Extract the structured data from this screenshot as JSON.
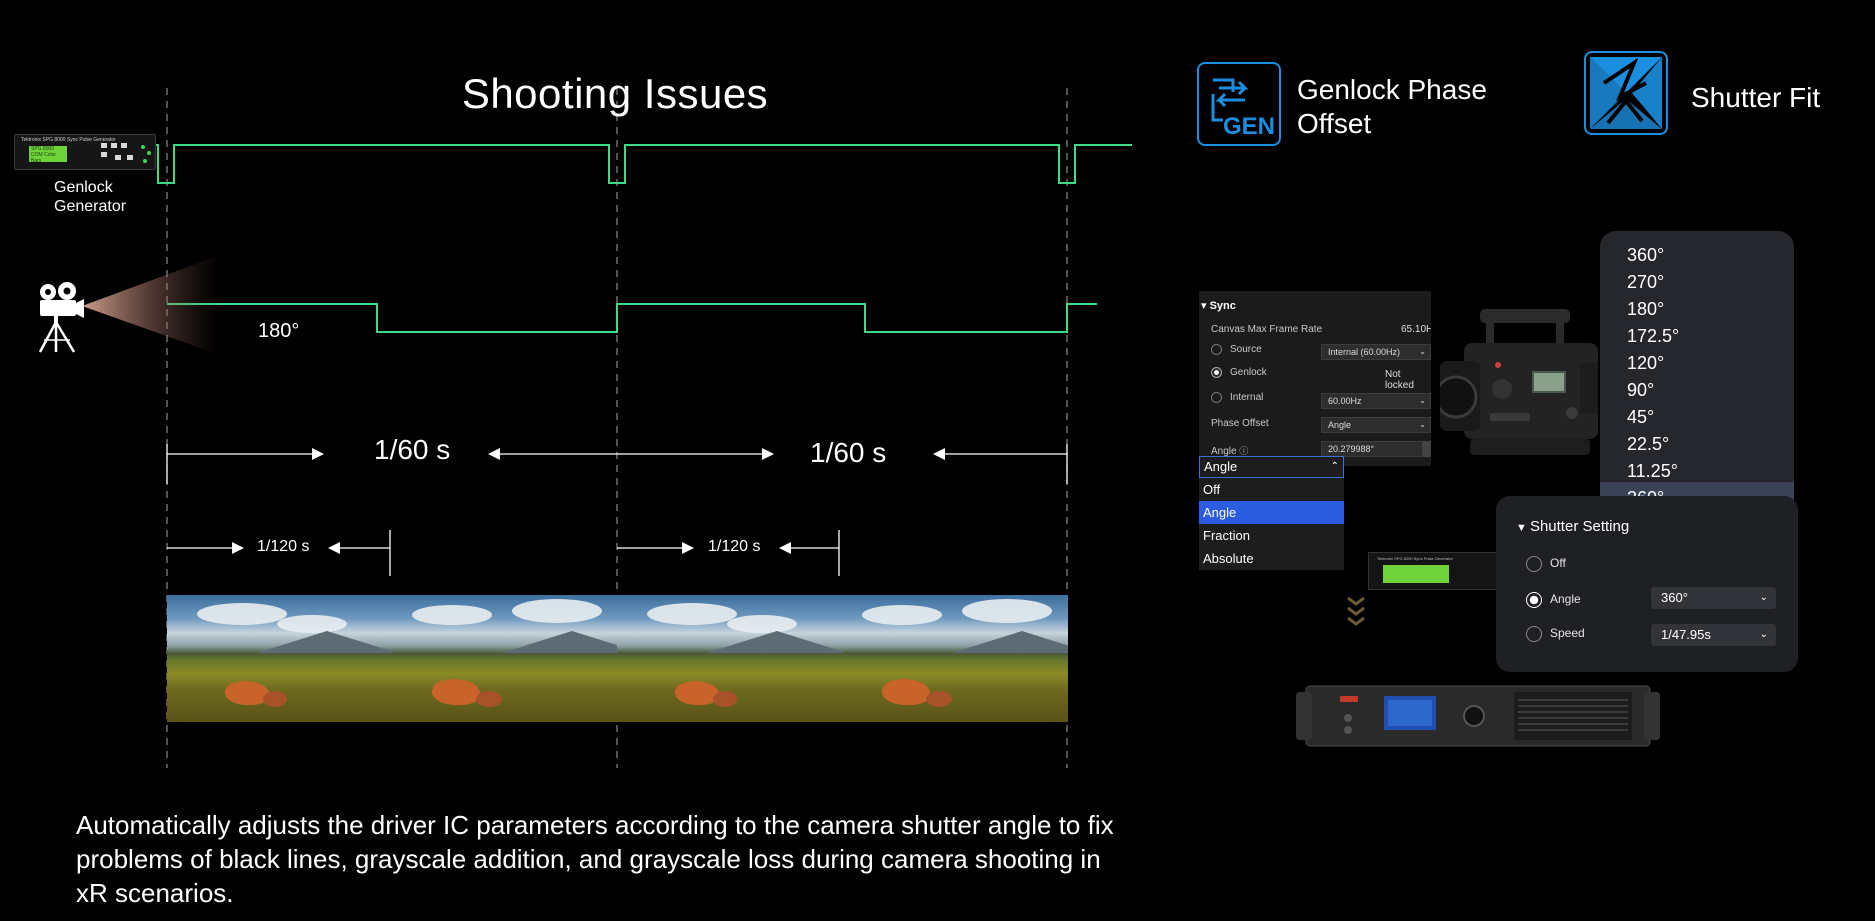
{
  "diagram": {
    "title": "Shooting Issues",
    "genlock_label": "Genlock\nGenerator",
    "shutter_angle": "180°",
    "period_left": "1/60 s",
    "period_right": "1/60 s",
    "half_left": "1/120 s",
    "half_right": "1/120 s",
    "device_brand": "Tektronix   SPG 8000 Sync Pulse Generator",
    "device_screen": [
      "SPG 8000",
      "COM Color Bars"
    ]
  },
  "description": "Automatically adjusts the driver IC parameters according to the camera shutter angle to fix problems of black lines, grayscale addition, and grayscale loss during camera shooting in xR scenarios.",
  "features": {
    "genlock": {
      "icon": "genlock-gen-icon",
      "icon_text": "GEN",
      "label": "Genlock Phase\nOffset"
    },
    "shutter": {
      "icon": "shutter-fit-icon",
      "label": "Shutter Fit"
    }
  },
  "sync_panel": {
    "header": "Sync",
    "canvas_label": "Canvas Max Frame Rate",
    "canvas_value": "65.10H",
    "source_label": "Source",
    "source_value": "Internal (60.00Hz)",
    "genlock_label": "Genlock",
    "genlock_value": "Not locked",
    "internal_label": "Internal",
    "internal_value": "60.00Hz",
    "phase_label": "Phase Offset",
    "phase_value": "Angle",
    "angle_label": "Angle",
    "angle_value": "20.279988°"
  },
  "angle_dropdown": {
    "current": "Angle",
    "options": [
      "Off",
      "Angle",
      "Fraction",
      "Absolute"
    ],
    "selected_index": 1
  },
  "degree_list": {
    "items": [
      "360°",
      "270°",
      "180°",
      "172.5°",
      "120°",
      "90°",
      "45°",
      "22.5°",
      "11.25°",
      "360°"
    ],
    "selected_index": 9
  },
  "shutter_setting": {
    "title": "Shutter Setting",
    "options": [
      {
        "label": "Off",
        "selected": false
      },
      {
        "label": "Angle",
        "selected": true,
        "value": "360°"
      },
      {
        "label": "Speed",
        "selected": false,
        "value": "1/47.95s"
      }
    ]
  },
  "colors": {
    "signal": "#3ddc84",
    "accent_blue": "#1c8ee0",
    "dropdown_select": "#2c5ce0"
  }
}
